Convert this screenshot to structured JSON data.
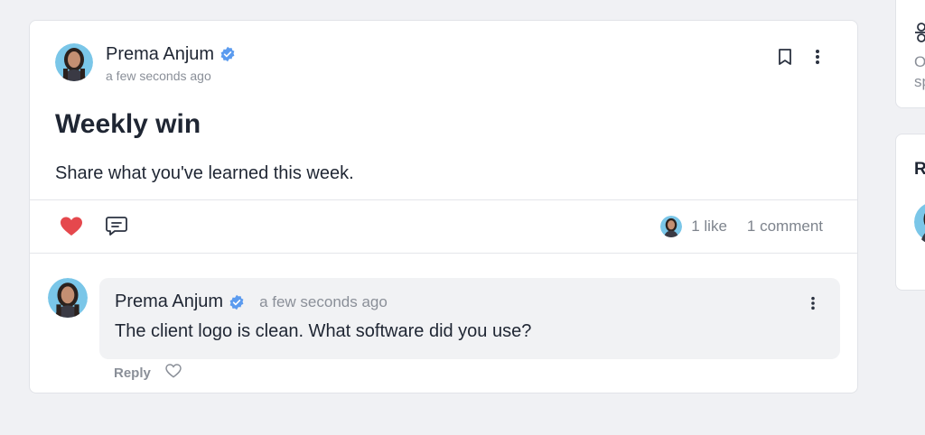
{
  "post": {
    "author": {
      "name": "Prema Anjum",
      "avatar": "avatar-photo"
    },
    "timestamp": "a few seconds ago",
    "title": "Weekly win",
    "body": "Share what you've learned this week.",
    "stats": {
      "likes": "1 like",
      "comments": "1 comment"
    }
  },
  "comment": {
    "author": "Prema Anjum",
    "timestamp": "a few seconds ago",
    "text": "The client logo is clean. What software did you use?",
    "reply_label": "Reply"
  },
  "sidebar": {
    "card1_text_line1": "O",
    "card1_text_line2": "sp",
    "card2_title": "R"
  },
  "colors": {
    "accent": "#4a90e2",
    "heart": "#e5484d",
    "verified": "#5b9bef"
  },
  "icons": [
    "verified-badge-icon",
    "bookmark-icon",
    "more-vertical-icon",
    "heart-icon",
    "comment-icon",
    "heart-outline-icon",
    "settings-icon"
  ]
}
